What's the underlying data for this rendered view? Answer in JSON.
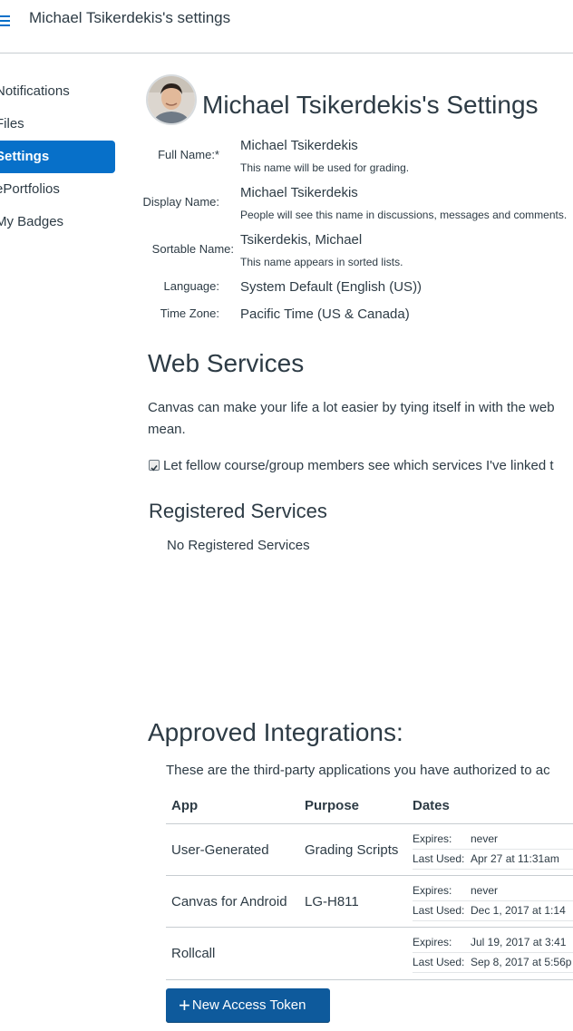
{
  "topbar": {
    "title": "Michael Tsikerdekis's settings"
  },
  "sidenav": {
    "items": [
      {
        "label": "Notifications",
        "active": false
      },
      {
        "label": "Files",
        "active": false
      },
      {
        "label": "Settings",
        "active": true
      },
      {
        "label": "ePortfolios",
        "active": false
      },
      {
        "label": "My Badges",
        "active": false
      }
    ]
  },
  "profile": {
    "title": "Michael Tsikerdekis's Settings",
    "fields": {
      "full_name": {
        "label": "Full Name:*",
        "value": "Michael Tsikerdekis",
        "hint": "This name will be used for grading."
      },
      "display_name": {
        "label": "Display Name:",
        "value": "Michael Tsikerdekis",
        "hint": "People will see this name in discussions, messages and comments."
      },
      "sortable_name": {
        "label": "Sortable Name:",
        "value": "Tsikerdekis, Michael",
        "hint": "This name appears in sorted lists."
      },
      "language": {
        "label": "Language:",
        "value": "System Default (English (US))"
      },
      "time_zone": {
        "label": "Time Zone:",
        "value": "Pacific Time (US & Canada)"
      }
    }
  },
  "web_services": {
    "heading": "Web Services",
    "desc_line1": "Canvas can make your life a lot easier by tying itself in with the web",
    "desc_line2": "mean.",
    "checkbox_label": "Let fellow course/group members see which services I've linked t",
    "checkbox_checked": true
  },
  "registered_services": {
    "heading": "Registered Services",
    "empty_text": "No Registered Services"
  },
  "integrations": {
    "heading": "Approved Integrations:",
    "desc": "These are the third-party applications you have authorized to ac",
    "columns": {
      "app": "App",
      "purpose": "Purpose",
      "dates": "Dates"
    },
    "expires_label": "Expires:",
    "last_used_label": "Last Used:",
    "rows": [
      {
        "app": "User-Generated",
        "purpose": "Grading Scripts",
        "expires": "never",
        "last_used": "Apr 27 at 11:31am"
      },
      {
        "app": "Canvas for Android",
        "purpose": "LG-H811",
        "expires": "never",
        "last_used": "Dec 1, 2017 at 1:14"
      },
      {
        "app": "Rollcall",
        "purpose": "",
        "expires": "Jul 19, 2017 at 3:41",
        "last_used": "Sep 8, 2017 at 5:56p"
      }
    ]
  },
  "new_token_button": {
    "label": "New Access Token"
  },
  "colors": {
    "accent": "#0770c9",
    "button": "#0e5a9c",
    "text": "#2d3b45"
  }
}
